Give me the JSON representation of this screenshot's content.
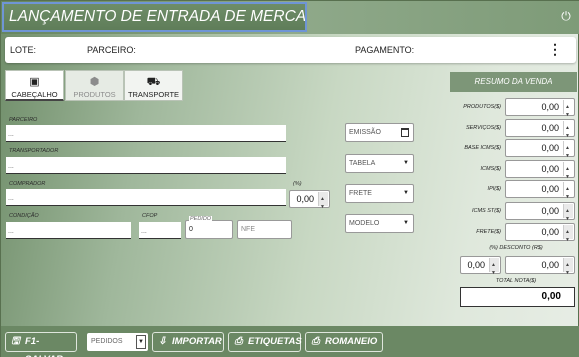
{
  "window": {
    "title": "LANÇAMENTO DE ENTRADA DE MERCADORIAS"
  },
  "infobar": {
    "lote": "LOTE:",
    "parceiro": "PARCEIRO:",
    "pagamento": "PAGAMENTO:"
  },
  "tabs": [
    {
      "label": "CABEÇALHO",
      "icon": "id-card-icon"
    },
    {
      "label": "PRODUTOS",
      "icon": "box-icon"
    },
    {
      "label": "TRANSPORTE",
      "icon": "truck-icon"
    }
  ],
  "form": {
    "parceiro": {
      "label": "PARCEIRO",
      "value": "..."
    },
    "transportador": {
      "label": "TRANSPORTADOR",
      "value": "..."
    },
    "comprador": {
      "label": "COMPRADOR",
      "value": "..."
    },
    "percent": {
      "label": "(%)",
      "value": "0,00"
    },
    "condicao": {
      "label": "CONDIÇÃO",
      "value": "..."
    },
    "cfop": {
      "label": "CFOP",
      "value": "..."
    },
    "pedido": {
      "label": "PEDIDO",
      "value": "0"
    },
    "nfe": {
      "placeholder": "NFE"
    },
    "emissao": {
      "placeholder": "EMISSÃO"
    },
    "tabela": {
      "value": "TABELA"
    },
    "frete": {
      "value": "FRETE"
    },
    "modelo": {
      "value": "MODELO"
    }
  },
  "summary": {
    "title": "RESUMO DA VENDA",
    "rows": [
      {
        "label": "PRODUTOS($)",
        "value": "0,00"
      },
      {
        "label": "SERVIÇOS($)",
        "value": "0,00"
      },
      {
        "label": "BASE ICMS($)",
        "value": "0,00"
      },
      {
        "label": "ICMS($)",
        "value": "0,00"
      },
      {
        "label": "IPI($)",
        "value": "0,00"
      },
      {
        "label": "ICMS ST($)",
        "value": "0,00"
      },
      {
        "label": "FRETE($)",
        "value": "0,00"
      }
    ],
    "desconto_label": "(%) DESCONTO (R$)",
    "desconto_pct": "0,00",
    "desconto_val": "0,00",
    "total_label": "TOTAL NOTA($)",
    "total_value": "0,00"
  },
  "toolbar": {
    "salvar": "F1-SALVAR",
    "pedidos": "PEDIDOS",
    "importar": "IMPORTAR",
    "etiquetas": "ETIQUETAS",
    "romaneio": "ROMANEIO"
  }
}
